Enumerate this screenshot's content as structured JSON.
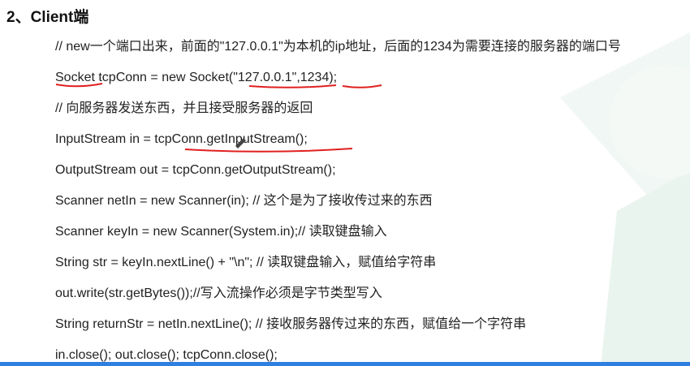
{
  "heading": "2、Client端",
  "lines": [
    "// new一个端口出来，前面的\"127.0.0.1\"为本机的ip地址，后面的1234为需要连接的服务器的端口号",
    "Socket tcpConn = new Socket(\"127.0.0.1\",1234);",
    "// 向服务器发送东西，并且接受服务器的返回",
    "InputStream in = tcpConn.getInputStream();",
    "OutputStream out = tcpConn.getOutputStream();",
    "Scanner netIn = new Scanner(in); // 这个是为了接收传过来的东西",
    "Scanner keyIn = new Scanner(System.in);// 读取键盘输入",
    "String str = keyIn.nextLine() + \"\\n\"; // 读取键盘输入，赋值给字符串",
    "out.write(str.getBytes());//写入流操作必须是字节类型写入",
    "String returnStr = netIn.nextLine(); // 接收服务器传过来的东西，赋值给一个字符串",
    "in.close();   out.close();   tcpConn.close();"
  ],
  "colors": {
    "annotation": "#e02020",
    "decor": "#eef6f2",
    "bottom_bar": "#2f7fe0"
  }
}
